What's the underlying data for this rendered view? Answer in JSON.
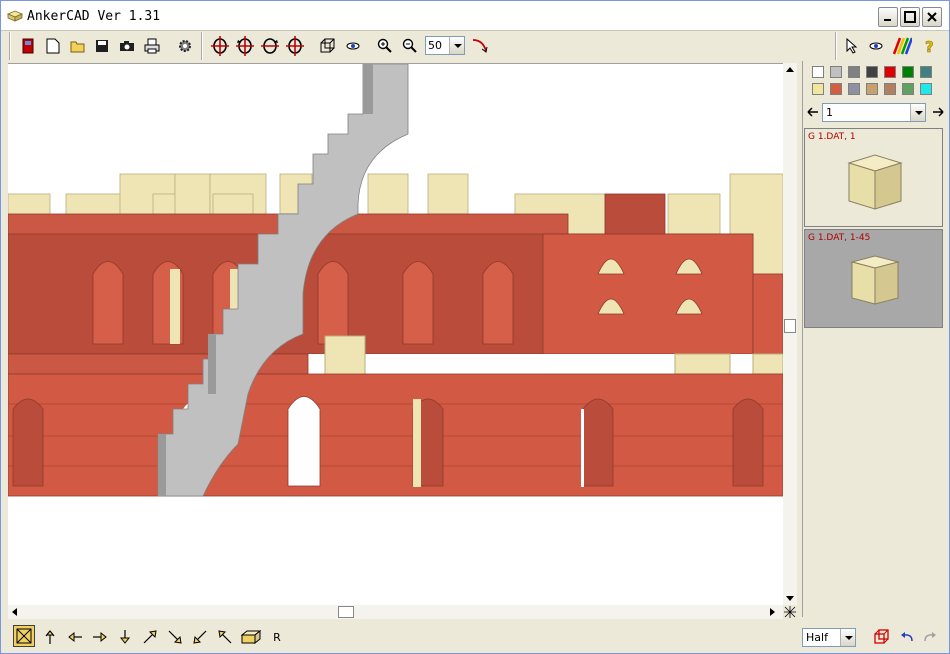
{
  "window": {
    "title": "AnkerCAD Ver 1.31"
  },
  "toolbar": {
    "zoom_value": "50"
  },
  "sidebar": {
    "page_value": "1",
    "colors": [
      "#ffffff",
      "#c0c0c0",
      "#808080",
      "#404040",
      "#e00000",
      "#008000",
      "#408080",
      "#f0e6a0",
      "#d06040",
      "#9090a0",
      "#c8a070",
      "#b08060",
      "#60a060",
      "#20e8e8"
    ],
    "thumbnails": [
      {
        "label": "G 1.DAT, 1",
        "selected": false
      },
      {
        "label": "G 1.DAT, 1-45",
        "selected": true
      }
    ]
  },
  "status": {
    "mode_value": "Half",
    "r_label": "R"
  }
}
